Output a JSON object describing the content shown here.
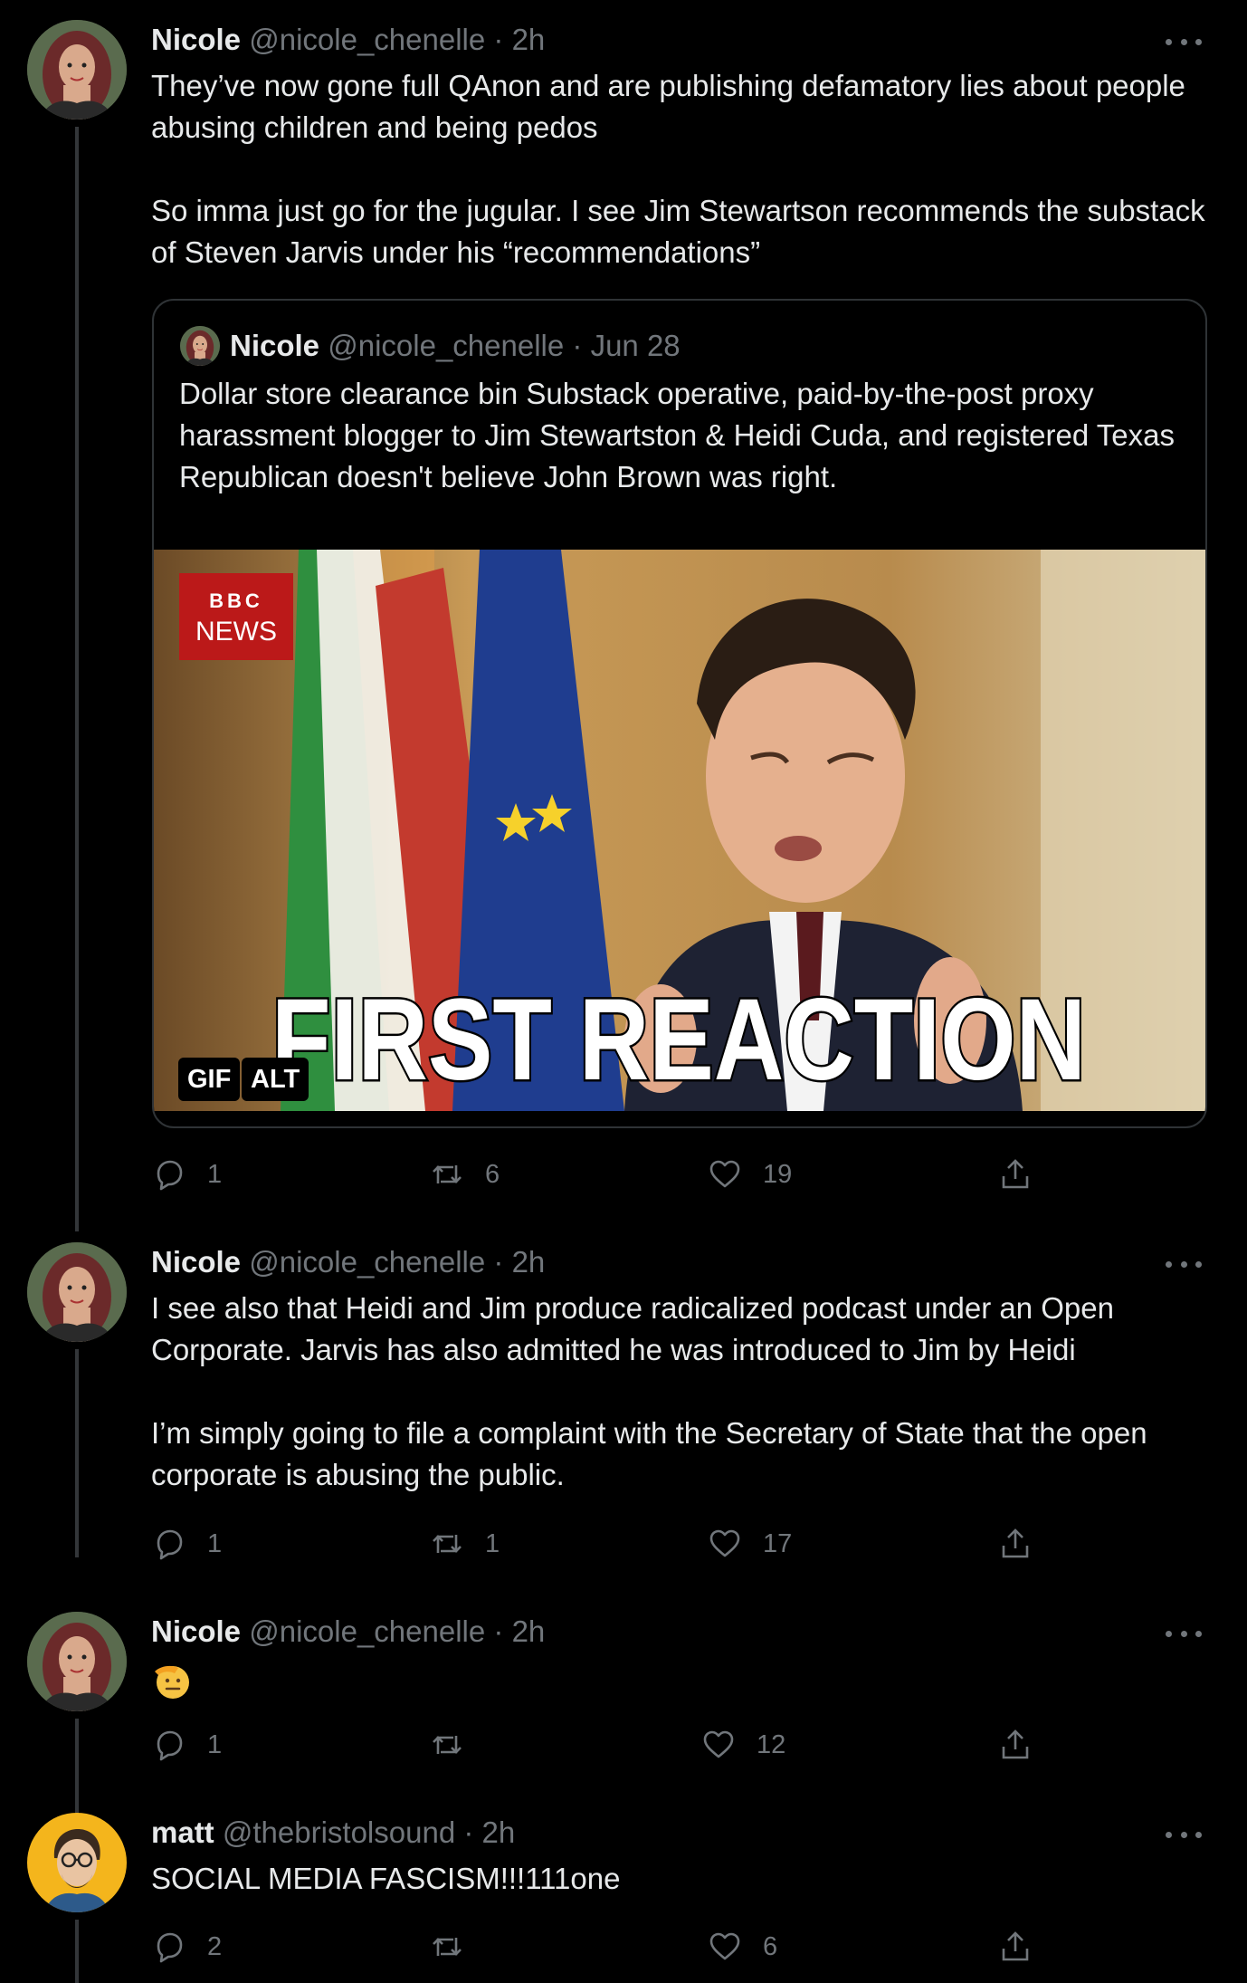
{
  "tweets": [
    {
      "name": "Nicole",
      "handle": "@nicole_chenelle",
      "time": "2h",
      "text": "They’ve now gone full QAnon and are publishing defamatory lies about people abusing children and being pedos\n\nSo imma just go for the jugular. I see Jim Stewartson recommends the substack of Steven Jarvis under his “recommendations”",
      "quote": {
        "name": "Nicole",
        "handle": "@nicole_chenelle",
        "time": "Jun 28",
        "text": "Dollar store clearance bin Substack operative, paid-by-the-post proxy harassment blogger to Jim Stewartston & Heidi Cuda, and registered Texas Republican doesn't believe John Brown was right.",
        "gif": {
          "logo_top": "BBC",
          "logo_bottom": "NEWS",
          "caption": "FIRST REACTION",
          "badge_gif": "GIF",
          "badge_alt": "ALT"
        }
      },
      "replies": "1",
      "retweets": "6",
      "likes": "19"
    },
    {
      "name": "Nicole",
      "handle": "@nicole_chenelle",
      "time": "2h",
      "text": "I see also that Heidi and Jim produce radicalized podcast under an Open Corporate. Jarvis has also admitted he was introduced to Jim by Heidi\n\nI’m simply going to file a complaint with the Secretary of State that the open corporate is abusing the public.",
      "replies": "1",
      "retweets": "1",
      "likes": "17"
    },
    {
      "name": "Nicole",
      "handle": "@nicole_chenelle",
      "time": "2h",
      "emoji": "saluting-face-emoji",
      "replies": "1",
      "retweets": "",
      "likes": "12"
    },
    {
      "name": "matt",
      "handle": "@thebristolsound",
      "time": "2h",
      "text": "SOCIAL MEDIA FASCISM!!!111one",
      "replies": "2",
      "retweets": "",
      "likes": "6"
    }
  ],
  "separator": "·",
  "colors": {
    "background": "#000000",
    "text": "#e7e9ea",
    "muted": "#71767b",
    "border": "#2f3336"
  }
}
